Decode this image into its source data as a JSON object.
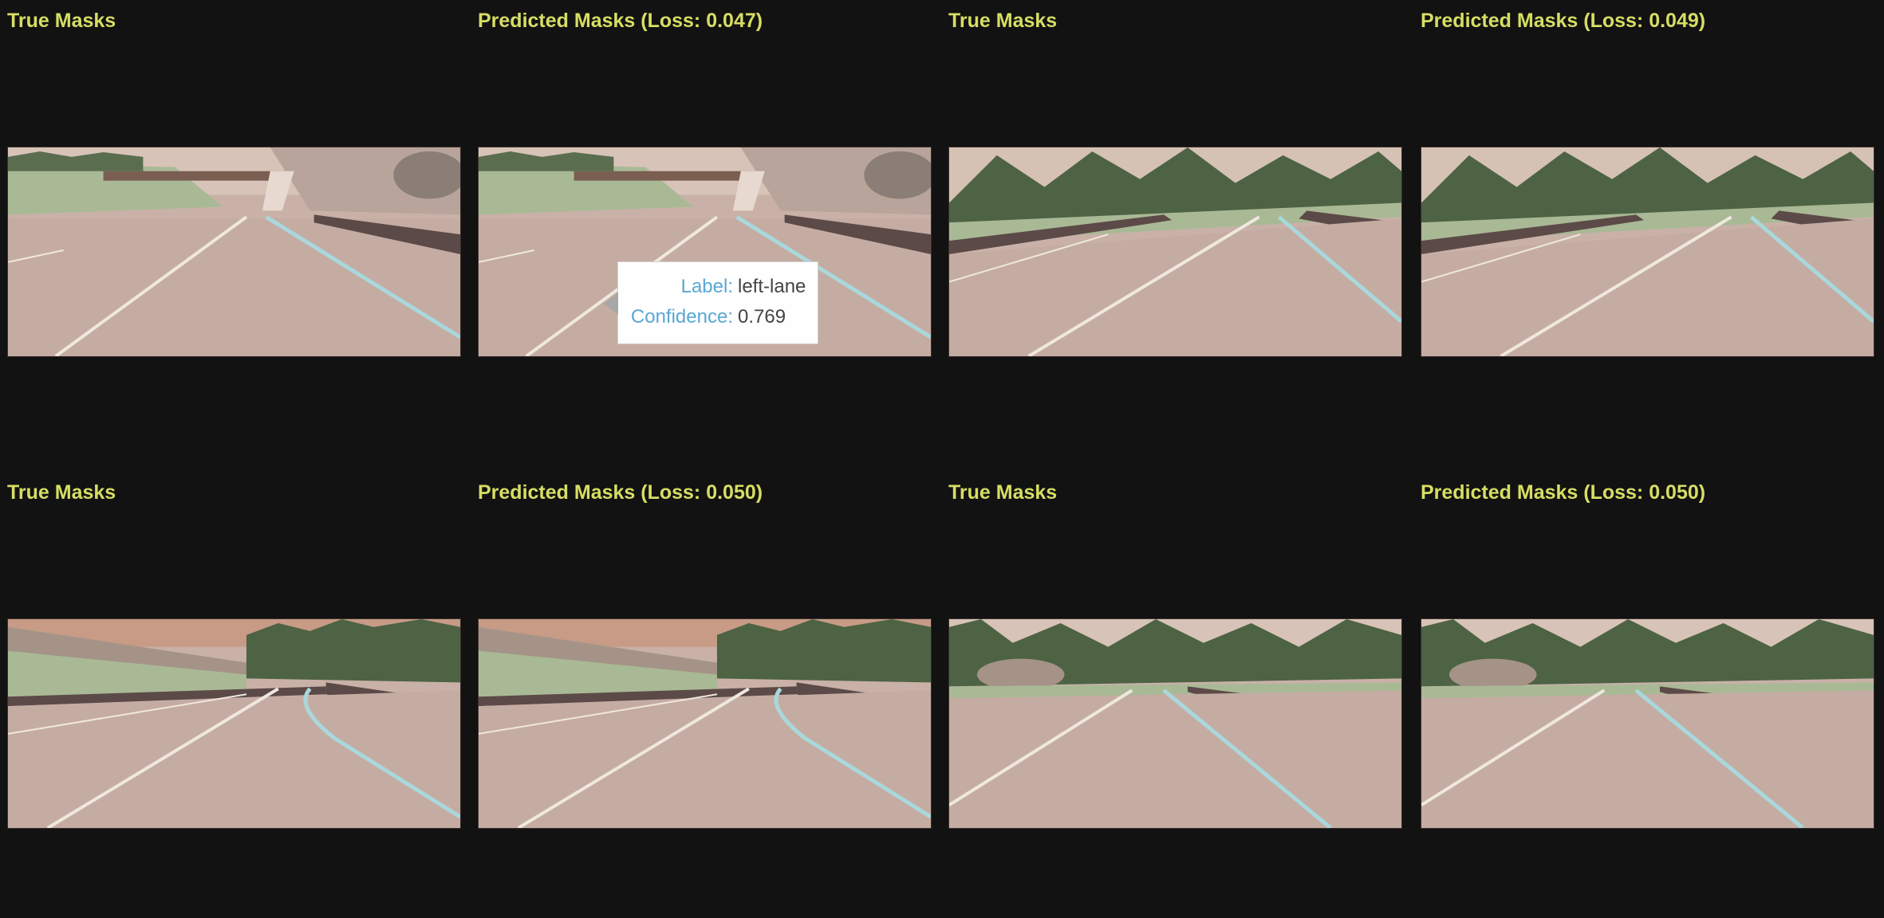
{
  "panels": [
    {
      "title": "True Masks",
      "scene": "overpass"
    },
    {
      "title": "Predicted Masks (Loss: 0.047)",
      "scene": "overpass"
    },
    {
      "title": "True Masks",
      "scene": "forest"
    },
    {
      "title": "Predicted Masks (Loss: 0.049)",
      "scene": "forest"
    },
    {
      "title": "True Masks",
      "scene": "hill"
    },
    {
      "title": "Predicted Masks (Loss: 0.050)",
      "scene": "hill"
    },
    {
      "title": "True Masks",
      "scene": "rocks"
    },
    {
      "title": "Predicted Masks (Loss: 0.050)",
      "scene": "rocks"
    }
  ],
  "tooltip": {
    "label_key": "Label:",
    "label_value": "left-lane",
    "confidence_key": "Confidence:",
    "confidence_value": "0.769"
  },
  "colors": {
    "background": "#121212",
    "title": "#d7de63",
    "road": "#c9b1a8",
    "grass": "#a9b995",
    "trees": "#4d6344",
    "sky": "#c79b86",
    "lane_white": "#efe8dd",
    "lane_cyan": "#a9d8dc",
    "tooltip_key": "#5aa7d4"
  }
}
